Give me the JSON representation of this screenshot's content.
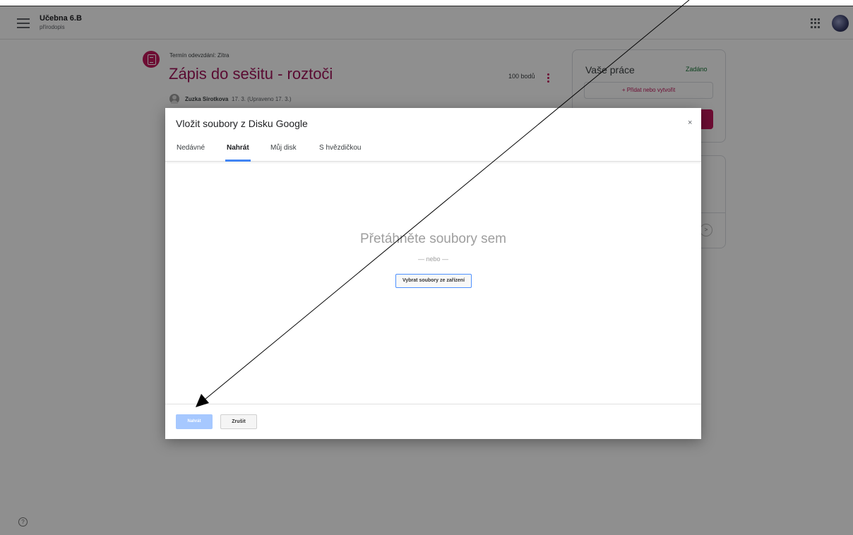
{
  "app": {
    "class_name": "Učebna 6.B",
    "class_subject": "přírodopis"
  },
  "assignment": {
    "due": "Termín odevzdání: Zítra",
    "title": "Zápis do sešitu - roztoči",
    "points": "100 bodů",
    "author": "Zuzka Sirotkova",
    "date": "17. 3. (Upraveno 17. 3.)"
  },
  "your_work": {
    "title": "Vaše práce",
    "status": "Zadáno",
    "add_label": "+ Přidat nebo vytvořit"
  },
  "dialog": {
    "title": "Vložit soubory z Disku Google",
    "close": "×",
    "tabs": [
      {
        "label": "Nedávné",
        "active": false
      },
      {
        "label": "Nahrát",
        "active": true
      },
      {
        "label": "Můj disk",
        "active": false
      },
      {
        "label": "S hvězdičkou",
        "active": false
      }
    ],
    "drop_text": "Přetáhněte soubory sem",
    "or_text": "— nebo —",
    "choose_button": "Vybrat soubory ze zařízení",
    "upload_button": "Nahrát",
    "cancel_button": "Zrušit"
  },
  "colors": {
    "accent": "#c2185b",
    "tab_indicator": "#4285f4",
    "upload_disabled": "#a6c8ff"
  },
  "icons": {
    "menu": "menu-icon",
    "apps": "apps-grid-icon",
    "help": "help-icon"
  },
  "help": "?"
}
